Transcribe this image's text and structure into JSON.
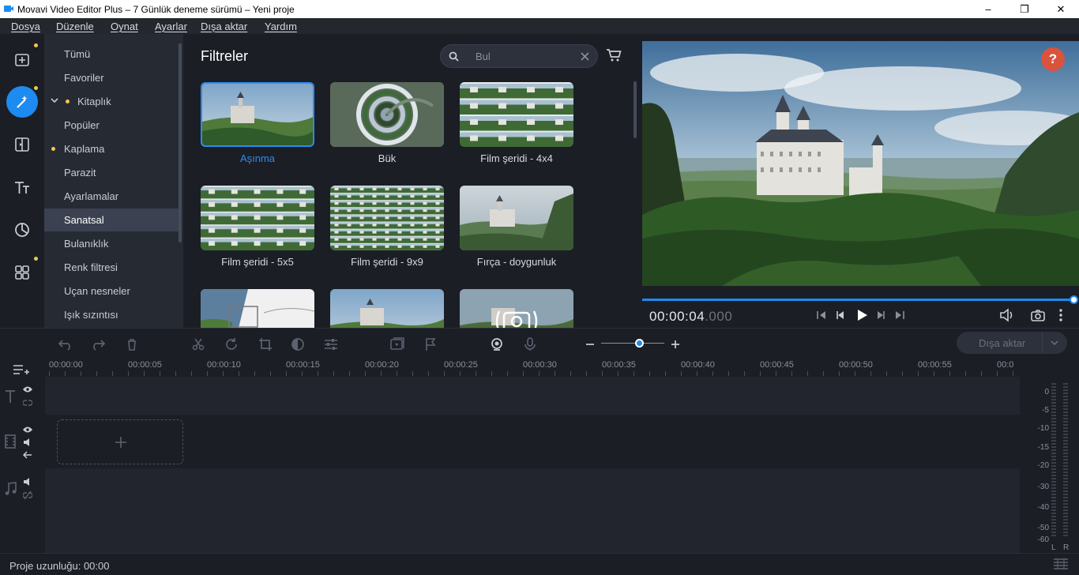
{
  "window": {
    "title": "Movavi Video Editor Plus – 7 Günlük deneme sürümü – Yeni proje",
    "controls": [
      "–",
      "❐",
      "✕"
    ]
  },
  "menu": [
    "Dosya",
    "Düzenle",
    "Oynat",
    "Ayarlar",
    "Dışa aktar",
    "Yardım"
  ],
  "rail": {
    "icons": [
      "import-icon",
      "filters-icon",
      "transitions-icon",
      "titles-icon",
      "stickers-icon",
      "more-tools-icon"
    ],
    "active": "filters-icon"
  },
  "categories": [
    {
      "label": "Tümü"
    },
    {
      "label": "Favoriler"
    },
    {
      "label": "Kitaplık"
    },
    {
      "label": "Popüler"
    },
    {
      "label": "Kaplama"
    },
    {
      "label": "Parazit"
    },
    {
      "label": "Ayarlamalar"
    },
    {
      "label": "Sanatsal",
      "selected": true
    },
    {
      "label": "Bulanıklık"
    },
    {
      "label": "Renk filtresi"
    },
    {
      "label": "Uçan nesneler"
    },
    {
      "label": "Işık sızıntısı"
    }
  ],
  "filters": {
    "title": "Filtreler",
    "search_placeholder": "Bul",
    "items": [
      {
        "label": "Aşınma",
        "selected": true
      },
      {
        "label": "Bük"
      },
      {
        "label": "Film şeridi - 4x4"
      },
      {
        "label": "Film şeridi - 5x5"
      },
      {
        "label": "Film şeridi - 9x9"
      },
      {
        "label": "Fırça - doygunluk"
      }
    ]
  },
  "player": {
    "help": "?",
    "time_main": "00:00:04",
    "time_ms": ".000",
    "progress": 1.0
  },
  "toolbar": {
    "export_label": "Dışa aktar"
  },
  "ruler": [
    "00:00:00",
    "00:00:05",
    "00:00:10",
    "00:00:15",
    "00:00:20",
    "00:00:25",
    "00:00:30",
    "00:00:35",
    "00:00:40",
    "00:00:45",
    "00:00:50",
    "00:00:55",
    "00:0"
  ],
  "meter": {
    "scale": [
      "0",
      "-5",
      "-10",
      "-15",
      "-20",
      "-30",
      "-40",
      "-50",
      "-60"
    ],
    "channels": [
      "L",
      "R"
    ]
  },
  "status": {
    "project_length": "Proje uzunluğu: 00:00"
  },
  "colors": {
    "accent": "#1d8bf0",
    "help": "#d9533d",
    "dot": "#f2c94c"
  }
}
